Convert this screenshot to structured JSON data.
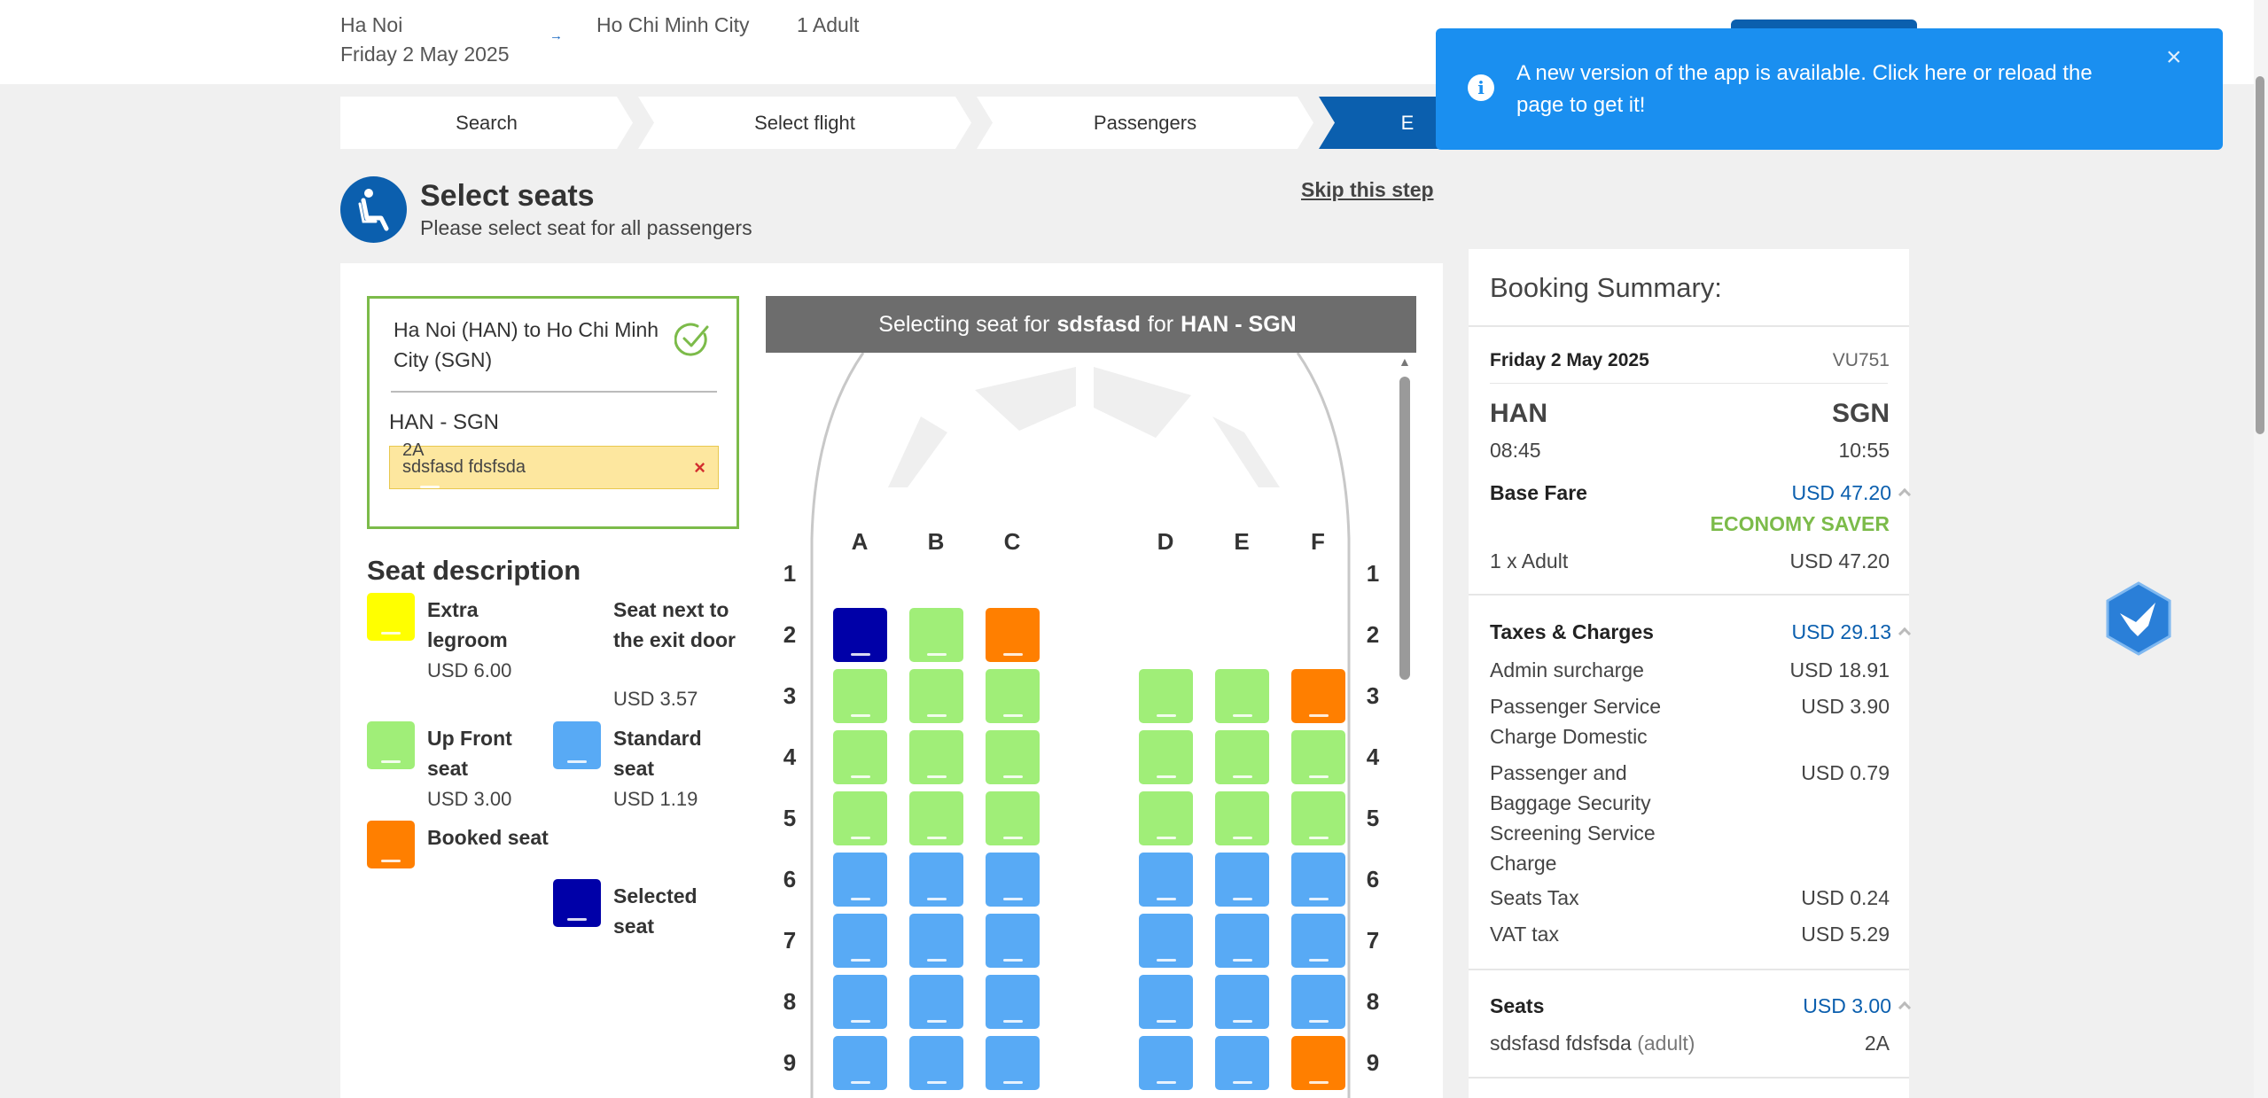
{
  "topbar": {
    "origin": "Ha Noi",
    "date": "Friday 2 May 2025",
    "arrow": "→",
    "destination": "Ho Chi Minh City",
    "passengers": "1 Adult"
  },
  "stepper": {
    "steps": [
      "Search",
      "Select flight",
      "Passengers",
      "E"
    ]
  },
  "header": {
    "title": "Select seats",
    "subtitle": "Please select seat for all passengers",
    "skip": "Skip this step"
  },
  "route": {
    "title_from": "Ha Noi (HAN)",
    "title_to_word": "to",
    "title_to": "Ho Chi Minh City (SGN)",
    "leg": "HAN - SGN",
    "passenger_name": "sdsfasd fdsfsda",
    "passenger_seat": "2A",
    "remove": "×"
  },
  "legend": {
    "title": "Seat description",
    "items": [
      {
        "label": "Extra legroom",
        "price": "USD 6.00",
        "color": "#ffff00"
      },
      {
        "label": "Seat next to the exit door",
        "price": "USD 3.57"
      },
      {
        "label": "Up Front seat",
        "price": "USD 3.00",
        "color": "#a0ee78"
      },
      {
        "label": "Standard seat",
        "price": "USD 1.19",
        "color": "#58aaf5"
      },
      {
        "label": "Booked seat",
        "color": "#ff7f00"
      },
      {
        "label": "Selected seat",
        "color": "#0000a8"
      }
    ]
  },
  "seatmap": {
    "header_prefix": "Selecting seat for",
    "header_passenger": "sdsfasd",
    "header_mid": "for",
    "header_leg": "HAN - SGN",
    "columns": [
      "A",
      "B",
      "C",
      "D",
      "E",
      "F"
    ],
    "rows": [
      "1",
      "2",
      "3",
      "4",
      "5",
      "6",
      "7",
      "8",
      "9"
    ],
    "seat_colors": {
      "selected": "#0000a8",
      "upfront": "#a0ee78",
      "booked": "#ff7f00",
      "standard": "#58aaf5"
    },
    "layout": [
      [
        "",
        "",
        "",
        "",
        "",
        ""
      ],
      [
        "selected",
        "upfront",
        "booked",
        "",
        "",
        ""
      ],
      [
        "upfront",
        "upfront",
        "upfront",
        "upfront",
        "upfront",
        "booked"
      ],
      [
        "upfront",
        "upfront",
        "upfront",
        "upfront",
        "upfront",
        "upfront"
      ],
      [
        "upfront",
        "upfront",
        "upfront",
        "upfront",
        "upfront",
        "upfront"
      ],
      [
        "standard",
        "standard",
        "standard",
        "standard",
        "standard",
        "standard"
      ],
      [
        "standard",
        "standard",
        "standard",
        "standard",
        "standard",
        "standard"
      ],
      [
        "standard",
        "standard",
        "standard",
        "standard",
        "standard",
        "standard"
      ],
      [
        "standard",
        "standard",
        "standard",
        "standard",
        "standard",
        "booked"
      ]
    ]
  },
  "summary": {
    "title": "Booking Summary:",
    "flight_date": "Friday 2 May 2025",
    "flight_no": "VU751",
    "from_code": "HAN",
    "to_code": "SGN",
    "dep_time": "08:45",
    "arr_time": "10:55",
    "base_fare_label": "Base Fare",
    "base_fare_value": "USD 47.20",
    "fare_class": "ECONOMY SAVER",
    "adult_label": "1 x Adult",
    "adult_value": "USD 47.20",
    "taxes_label": "Taxes & Charges",
    "taxes_value": "USD 29.13",
    "admin_label": "Admin surcharge",
    "admin_value": "USD 18.91",
    "psc_label": "Passenger Service Charge Domestic",
    "psc_value": "USD 3.90",
    "pbs_label": "Passenger and Baggage Security Screening Service Charge",
    "pbs_value": "USD 0.79",
    "seats_tax_label": "Seats Tax",
    "seats_tax_value": "USD 0.24",
    "vat_label": "VAT tax",
    "vat_value": "USD 5.29",
    "seats_label": "Seats",
    "seats_value": "USD 3.00",
    "seat_pax_name": "sdsfasd fdsfsda",
    "seat_pax_type": "(adult)",
    "seat_pax_seat": "2A"
  },
  "toast": {
    "message": "A new version of the app is available. Click here or reload the page to get it!",
    "icon": "i",
    "close": "×"
  },
  "colors": {
    "primary": "#0b5fae",
    "toast": "#1a8ff0",
    "green": "#7cbb4a"
  }
}
